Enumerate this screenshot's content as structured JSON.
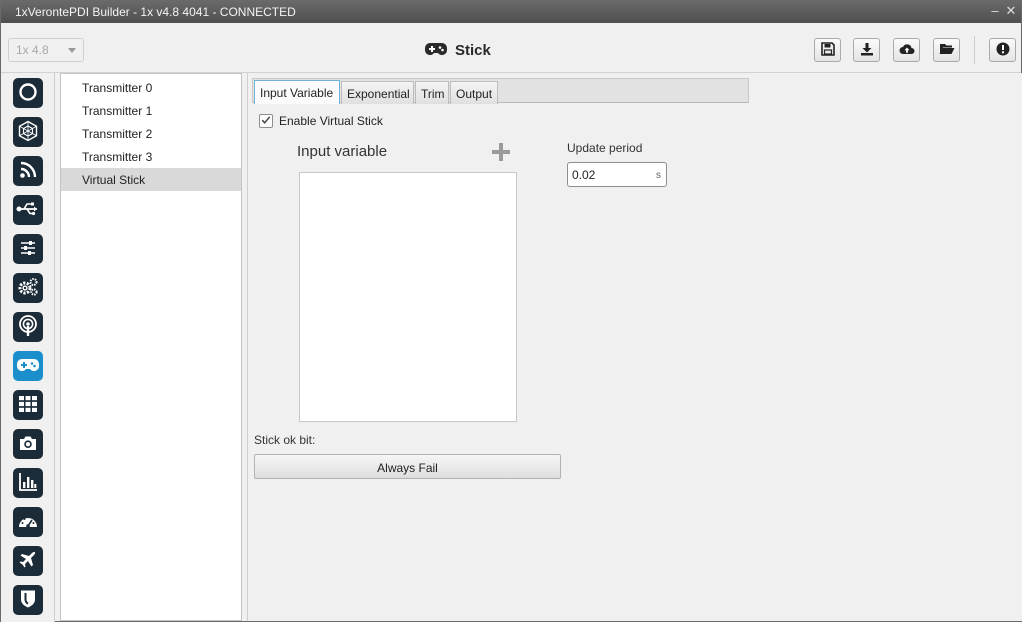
{
  "window": {
    "title": "1xVerontePDI Builder - 1x v4.8 4041 - CONNECTED",
    "minimize_glyph": "–",
    "close_glyph": "✕"
  },
  "toolbar": {
    "version_select": {
      "value": "1x 4.8",
      "enabled": false
    },
    "page_title": "Stick",
    "page_icon": "gamepad-icon",
    "buttons": [
      {
        "name": "save-button",
        "icon": "save-icon"
      },
      {
        "name": "download-button",
        "icon": "download-icon"
      },
      {
        "name": "cloud-upload-button",
        "icon": "cloud-upload-icon"
      },
      {
        "name": "open-folder-button",
        "icon": "folder-open-icon"
      },
      {
        "name": "alert-button",
        "icon": "alert-icon"
      }
    ]
  },
  "sidebar": {
    "items": [
      {
        "name": "sidebar-item-power",
        "icon": "circle-power-icon"
      },
      {
        "name": "sidebar-item-hexagon",
        "icon": "hexagon-icon"
      },
      {
        "name": "sidebar-item-feed",
        "icon": "rss-feed-icon"
      },
      {
        "name": "sidebar-item-usb",
        "icon": "usb-icon"
      },
      {
        "name": "sidebar-item-sliders",
        "icon": "sliders-icon"
      },
      {
        "name": "sidebar-item-gears",
        "icon": "gears-icon"
      },
      {
        "name": "sidebar-item-broadcast",
        "icon": "broadcast-icon"
      },
      {
        "name": "sidebar-item-stick",
        "icon": "gamepad-icon",
        "active": true
      },
      {
        "name": "sidebar-item-grid",
        "icon": "grid-icon"
      },
      {
        "name": "sidebar-item-camera",
        "icon": "camera-icon"
      },
      {
        "name": "sidebar-item-chart",
        "icon": "bar-chart-icon"
      },
      {
        "name": "sidebar-item-dashboard",
        "icon": "dashboard-icon"
      },
      {
        "name": "sidebar-item-flight",
        "icon": "airplane-icon"
      },
      {
        "name": "sidebar-item-shield",
        "icon": "shield-icon"
      }
    ],
    "active_color": "#1a8fcc",
    "icon_bg_color": "#1b2b38"
  },
  "list": {
    "items": [
      {
        "label": "Transmitter 0"
      },
      {
        "label": "Transmitter 1"
      },
      {
        "label": "Transmitter 2"
      },
      {
        "label": "Transmitter 3"
      },
      {
        "label": "Virtual Stick",
        "selected": true
      }
    ]
  },
  "main": {
    "tabs": [
      {
        "label": "Input Variable",
        "active": true
      },
      {
        "label": "Exponential"
      },
      {
        "label": "Trim"
      },
      {
        "label": "Output"
      }
    ],
    "enable_virtual_stick": {
      "label": "Enable Virtual Stick",
      "checked": true
    },
    "input_variable": {
      "label": "Input variable",
      "add_glyph": "+"
    },
    "update_period": {
      "label": "Update period",
      "value": "0.02",
      "unit": "s"
    },
    "stick_ok_bit": {
      "label": "Stick ok bit:",
      "button_label": "Always Fail"
    }
  }
}
